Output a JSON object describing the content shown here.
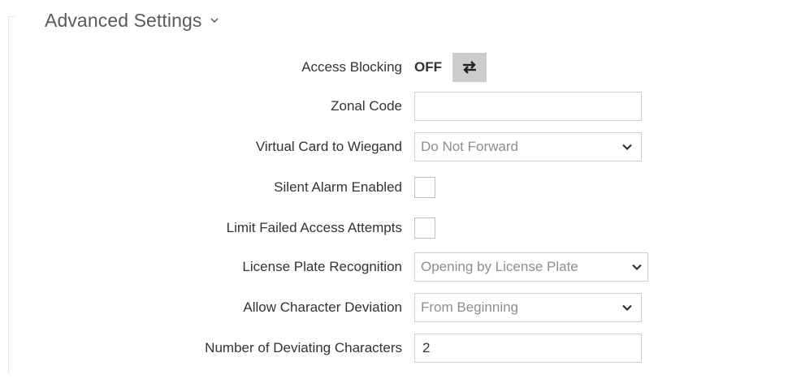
{
  "section": {
    "title": "Advanced Settings"
  },
  "rows": {
    "access_blocking": {
      "label": "Access Blocking",
      "state": "OFF"
    },
    "zonal_code": {
      "label": "Zonal Code",
      "value": ""
    },
    "virtual_card": {
      "label": "Virtual Card to Wiegand",
      "selected": "Do Not Forward"
    },
    "silent_alarm": {
      "label": "Silent Alarm Enabled",
      "checked": false
    },
    "limit_failed": {
      "label": "Limit Failed Access Attempts",
      "checked": false
    },
    "license_plate": {
      "label": "License Plate Recognition",
      "selected": "Opening by License Plate"
    },
    "char_deviation": {
      "label": "Allow Character Deviation",
      "selected": "From Beginning"
    },
    "num_deviating": {
      "label": "Number of Deviating Characters",
      "value": "2"
    }
  },
  "icons": {
    "section_toggle": "chevron-down-icon",
    "toggle": "swap-arrows-icon",
    "select_arrow": "chevron-down-icon"
  },
  "colors": {
    "toggle_bg": "#cccccc",
    "border": "#cfcfcf",
    "select_text": "#8e8e8e",
    "title_text": "#5a5a5a"
  }
}
